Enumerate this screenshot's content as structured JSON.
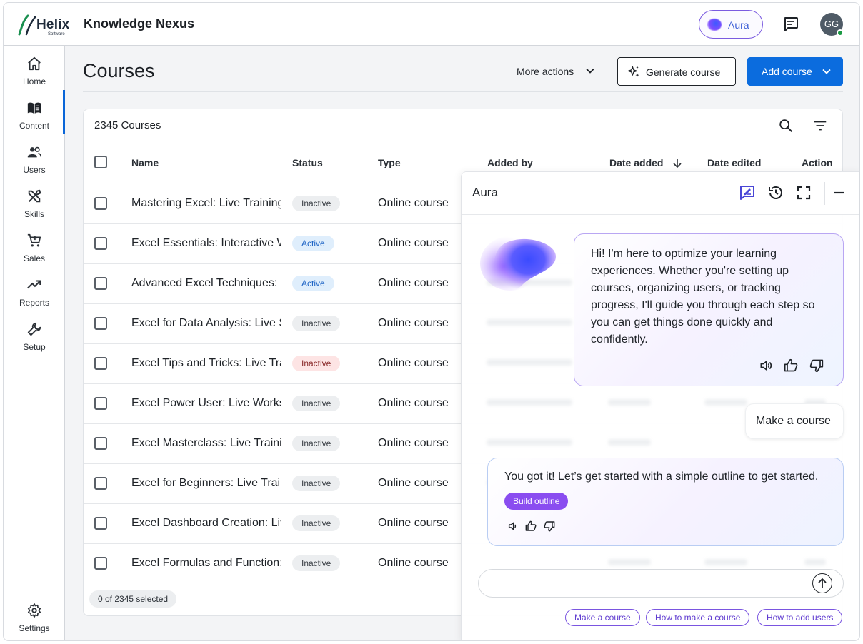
{
  "header": {
    "logo_word": "Helix",
    "logo_sub": "Software",
    "app_title": "Knowledge Nexus",
    "aura_label": "Aura",
    "avatar_initials": "GG"
  },
  "nav": {
    "items": [
      {
        "label": "Home",
        "icon": "home-icon"
      },
      {
        "label": "Content",
        "icon": "book-icon",
        "active": true
      },
      {
        "label": "Users",
        "icon": "users-icon"
      },
      {
        "label": "Skills",
        "icon": "tools-icon"
      },
      {
        "label": "Sales",
        "icon": "cart-icon"
      },
      {
        "label": "Reports",
        "icon": "trending-icon"
      },
      {
        "label": "Setup",
        "icon": "wrench-icon"
      }
    ],
    "settings_label": "Settings"
  },
  "page": {
    "title": "Courses",
    "more_actions": "More actions",
    "generate_course": "Generate course",
    "add_course": "Add course"
  },
  "table": {
    "count_label": "2345 Courses",
    "columns": {
      "name": "Name",
      "status": "Status",
      "type": "Type",
      "added_by": "Added by",
      "date_added": "Date added",
      "date_edited": "Date edited",
      "action": "Action"
    },
    "rows": [
      {
        "name": "Mastering Excel: Live Training",
        "status": "Inactive",
        "status_kind": "inactive",
        "type": "Online course"
      },
      {
        "name": "Excel Essentials: Interactive W",
        "status": "Active",
        "status_kind": "active",
        "type": "Online course"
      },
      {
        "name": "Advanced Excel Techniques:",
        "status": "Active",
        "status_kind": "active",
        "type": "Online course"
      },
      {
        "name": "Excel for Data Analysis: Live S",
        "status": "Inactive",
        "status_kind": "inactive",
        "type": "Online course"
      },
      {
        "name": "Excel Tips and Tricks: Live Tra",
        "status": "Inactive",
        "status_kind": "inactive-red",
        "type": "Online course"
      },
      {
        "name": "Excel Power User: Live Works",
        "status": "Inactive",
        "status_kind": "inactive",
        "type": "Online course"
      },
      {
        "name": "Excel Masterclass: Live Traini",
        "status": "Inactive",
        "status_kind": "inactive",
        "type": "Online course"
      },
      {
        "name": "Excel for Beginners: Live Trai",
        "status": "Inactive",
        "status_kind": "inactive",
        "type": "Online course"
      },
      {
        "name": "Excel Dashboard Creation: Liv",
        "status": "Inactive",
        "status_kind": "inactive",
        "type": "Online course"
      },
      {
        "name": "Excel Formulas and Function:",
        "status": "Inactive",
        "status_kind": "inactive",
        "type": "Online course"
      }
    ],
    "selection_label": "0 of 2345 selected"
  },
  "aura_panel": {
    "title": "Aura",
    "greeting": "Hi! I'm here to optimize your learning experiences. Whether you're setting up courses, organizing users, or tracking progress, I'll guide you through each step so you can get things done quickly and confidently.",
    "user_message": "Make a course",
    "reply": "You got it! Let’s get started with a simple outline to get started.",
    "build_outline": "Build outline",
    "input_value": "",
    "suggestions": [
      "Make a course",
      "How to make a course",
      "How to add users"
    ]
  },
  "colors": {
    "primary": "#0b6cde",
    "aura_accent": "#7a55e0",
    "active_badge": "#dfeefc",
    "inactive_badge": "#eceef0",
    "alert_badge": "#fde4e4"
  }
}
